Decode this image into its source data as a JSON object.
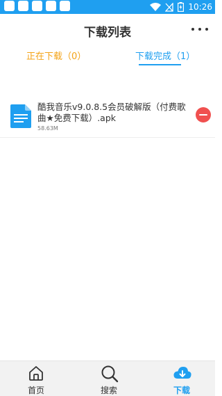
{
  "status_bar": {
    "time": "10:26",
    "notification_icons": [
      "app-icon",
      "app-icon",
      "app-icon",
      "app-icon",
      "app-icon"
    ],
    "system_icons": [
      "wifi-icon",
      "no-signal-icon",
      "battery-charging-icon"
    ]
  },
  "header": {
    "title": "下载列表",
    "more_icon": "more-dots-icon"
  },
  "tabs": {
    "downloading_label": "正在下载（0）",
    "completed_label": "下载完成（1）",
    "active_tab": "completed"
  },
  "downloads": [
    {
      "file_icon": "document-icon",
      "name": "酷我音乐v9.0.8.5会员破解版（付费歌曲★免费下载）.apk",
      "size": "58.63M",
      "action_icon": "delete-icon"
    }
  ],
  "bottom_nav": {
    "items": [
      {
        "label": "首页",
        "icon": "home-icon",
        "active": false
      },
      {
        "label": "搜索",
        "icon": "search-icon",
        "active": false
      },
      {
        "label": "下载",
        "icon": "cloud-download-icon",
        "active": true
      }
    ]
  },
  "colors": {
    "accent": "#1f9ff0",
    "pending_tab": "#f4a317",
    "delete": "#f0504f"
  }
}
